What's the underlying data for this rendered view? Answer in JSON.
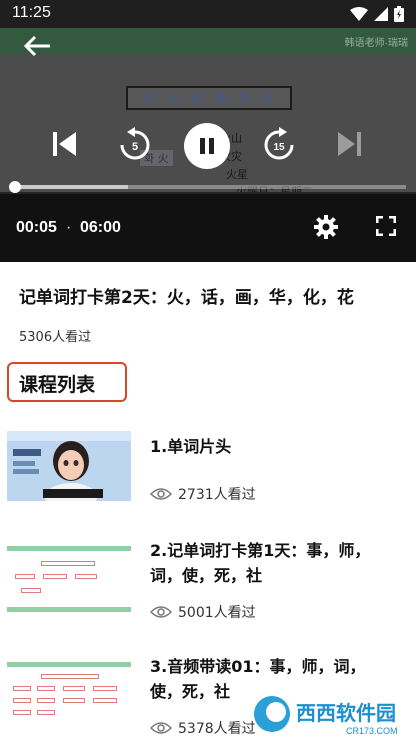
{
  "status_bar": {
    "time": "11:25"
  },
  "player": {
    "watermark": "韩语老师·瑞瑞",
    "video_word_card": "화：火，话，画，华，化",
    "video_tag": "화 火",
    "video_words": [
      "火山",
      "火灾",
      "火星",
      "火曜日：星期二"
    ],
    "current_time": "00:05",
    "separator": "·",
    "duration": "06:00",
    "progress_fraction": 0.0014,
    "buffered_fraction": 0.29,
    "skip_back_seconds": "5",
    "skip_forward_seconds": "15"
  },
  "course": {
    "title": "记单词打卡第2天：火，话，画，华，化，花",
    "views": "5306人看过"
  },
  "section": {
    "label": "课程列表"
  },
  "lessons": [
    {
      "title": "1.单词片头",
      "views": "2731人看过"
    },
    {
      "title": "2.记单词打卡第1天：事，师，词，使，死，社",
      "views": "5001人看过"
    },
    {
      "title": "3.音频带读01：事，师，词，使，死，社",
      "views": "5378人看过"
    }
  ],
  "watermark": {
    "text": "西西软件园",
    "sub": "CR173.COM"
  },
  "colors": {
    "accent_red": "#d9472b",
    "sheet_green": "#8fd0a6",
    "player_bar": "#111111"
  }
}
